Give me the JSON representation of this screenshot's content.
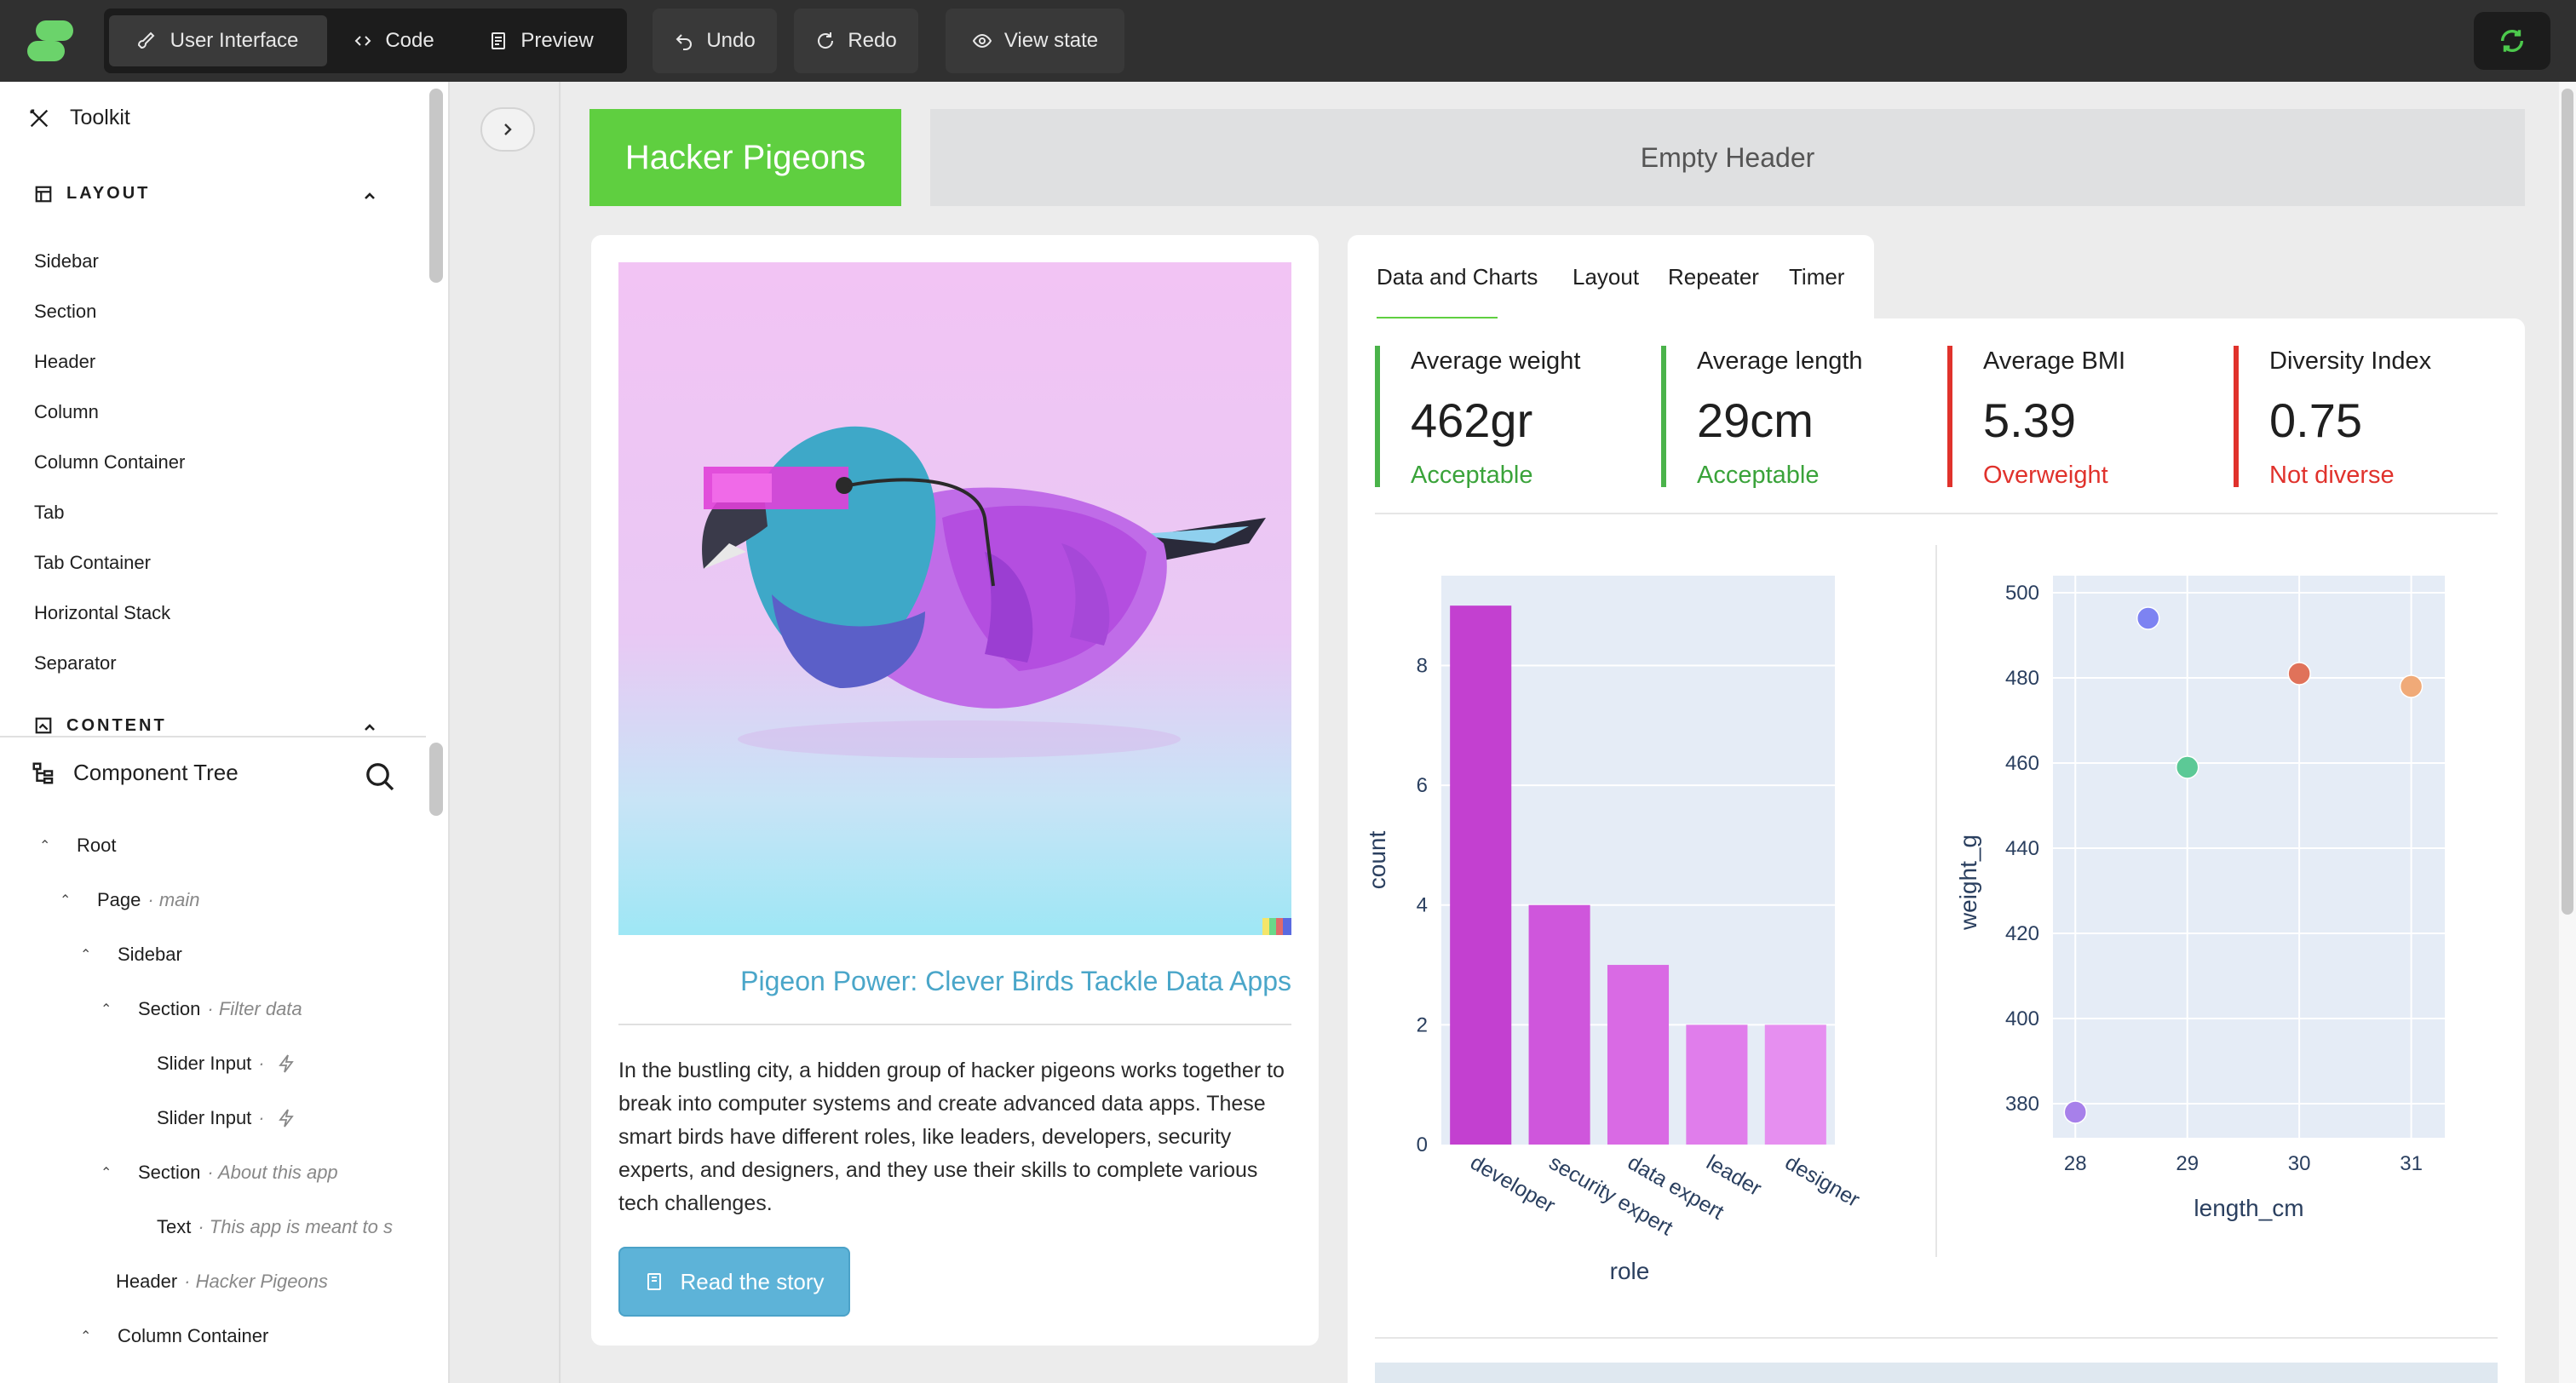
{
  "toolbar": {
    "user_interface_label": "User Interface",
    "code_label": "Code",
    "preview_label": "Preview",
    "undo_label": "Undo",
    "redo_label": "Redo",
    "view_state_label": "View state"
  },
  "toolkit": {
    "title": "Toolkit",
    "layout_section": "LAYOUT",
    "layout_items": [
      "Sidebar",
      "Section",
      "Header",
      "Column",
      "Column Container",
      "Tab",
      "Tab Container",
      "Horizontal Stack",
      "Separator"
    ],
    "content_section": "CONTENT"
  },
  "component_tree": {
    "title": "Component Tree",
    "nodes": [
      {
        "label": "Root",
        "sub": ""
      },
      {
        "label": "Page",
        "sub": "· main"
      },
      {
        "label": "Sidebar",
        "sub": ""
      },
      {
        "label": "Section",
        "sub": "· Filter data"
      },
      {
        "label": "Slider Input",
        "sub": "·"
      },
      {
        "label": "Slider Input",
        "sub": "·"
      },
      {
        "label": "Section",
        "sub": "· About this app"
      },
      {
        "label": "Text",
        "sub": "· This app is meant to s"
      },
      {
        "label": "Header",
        "sub": "· Hacker Pigeons"
      },
      {
        "label": "Column Container",
        "sub": ""
      }
    ]
  },
  "app": {
    "header_title": "Hacker Pigeons",
    "empty_header": "Empty Header",
    "card": {
      "link_title": "Pigeon Power: Clever Birds Tackle Data Apps",
      "body": "In the bustling city, a hidden group of hacker pigeons works together to break into computer systems and create advanced data apps. These smart birds have different roles, like leaders, developers, security experts, and designers, and they use their skills to complete various tech challenges.",
      "button_label": "Read the story"
    },
    "tabs": [
      "Data and Charts",
      "Layout",
      "Repeater",
      "Timer"
    ],
    "active_tab": "Data and Charts",
    "metrics": [
      {
        "label": "Average weight",
        "value": "462gr",
        "delta": "Acceptable",
        "status": "good"
      },
      {
        "label": "Average length",
        "value": "29cm",
        "delta": "Acceptable",
        "status": "good"
      },
      {
        "label": "Average BMI",
        "value": "5.39",
        "delta": "Overweight",
        "status": "bad"
      },
      {
        "label": "Diversity Index",
        "value": "0.75",
        "delta": "Not diverse",
        "status": "bad"
      }
    ]
  },
  "chart_data": [
    {
      "type": "bar",
      "categories": [
        "developer",
        "security expert",
        "data expert",
        "leader",
        "designer"
      ],
      "values": [
        9,
        4,
        3,
        2,
        2
      ],
      "colors": [
        "#c340d0",
        "#cf56dc",
        "#d96ae4",
        "#e07deb",
        "#e68ff0"
      ],
      "xlabel": "role",
      "ylabel": "count",
      "ylim": [
        0,
        9.5
      ],
      "yticks": [
        0,
        2,
        4,
        6,
        8
      ],
      "grid": true
    },
    {
      "type": "scatter",
      "points": [
        {
          "x": 28,
          "y": 378,
          "color": "#a780ea"
        },
        {
          "x": 28.65,
          "y": 494,
          "color": "#7d83f2"
        },
        {
          "x": 29,
          "y": 459,
          "color": "#5cc996"
        },
        {
          "x": 30,
          "y": 481,
          "color": "#e0725a"
        },
        {
          "x": 31,
          "y": 478,
          "color": "#f0aa78"
        }
      ],
      "xlabel": "length_cm",
      "ylabel": "weight_g",
      "xlim": [
        27.8,
        31.3
      ],
      "ylim": [
        372,
        504
      ],
      "xticks": [
        28,
        29,
        30,
        31
      ],
      "yticks": [
        380,
        400,
        420,
        440,
        460,
        480,
        500
      ],
      "grid": true
    }
  ]
}
